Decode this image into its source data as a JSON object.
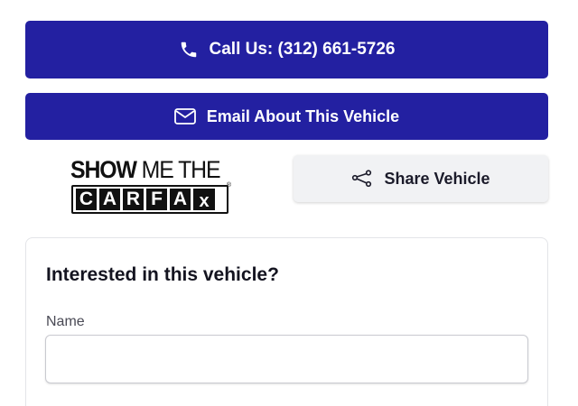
{
  "actions": {
    "call_label": "Call Us: (312) 661-5726",
    "email_label": "Email About This Vehicle",
    "share_label": "Share Vehicle"
  },
  "carfax": {
    "line1_bold": "SHOW",
    "line1_rest": " ME THE",
    "letters": [
      "C",
      "A",
      "R",
      "F",
      "A"
    ],
    "x_letter": "x",
    "registered": "®"
  },
  "inquiry_form": {
    "title": "Interested in this vehicle?",
    "name_label": "Name",
    "name_value": "",
    "name_placeholder": ""
  },
  "colors": {
    "primary": "#2320a1",
    "secondary_bg": "#f1f2f4",
    "text_dark": "#141420"
  },
  "icons": {
    "call": "phone-icon",
    "email": "envelope-icon",
    "share": "share-icon"
  }
}
